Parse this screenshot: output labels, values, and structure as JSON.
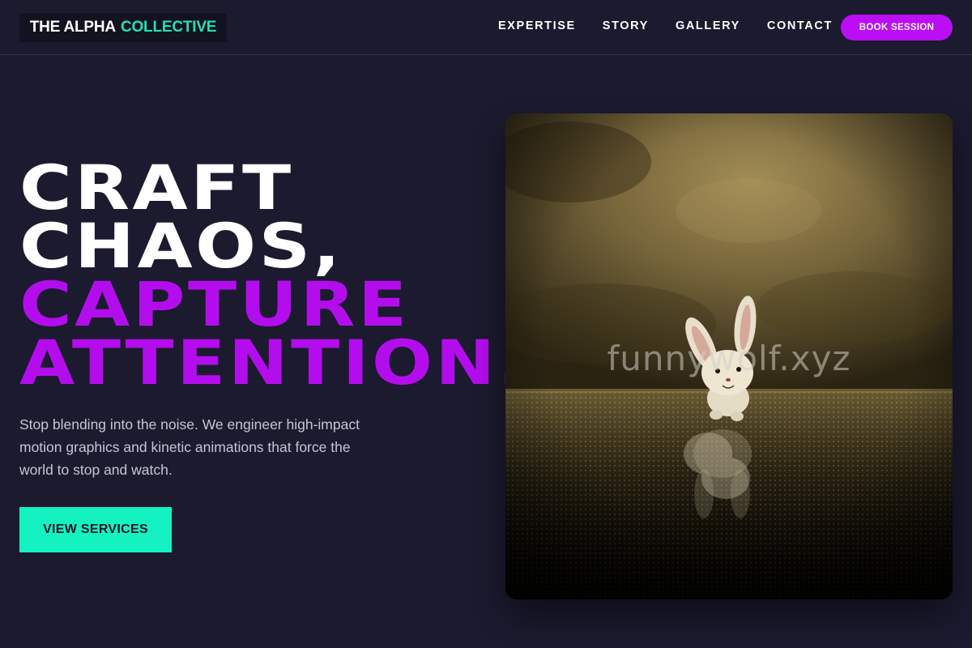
{
  "header": {
    "logo_part1": "THE ALPHA",
    "logo_part2": "COLLECTIVE",
    "nav": [
      {
        "label": "EXPERTISE"
      },
      {
        "label": "STORY"
      },
      {
        "label": "GALLERY"
      },
      {
        "label": "CONTACT"
      }
    ],
    "cta_label": "BOOK SESSION"
  },
  "hero": {
    "headline_lines": [
      "CRAFT",
      "CHAOS,",
      "CAPTURE",
      "ATTENTION."
    ],
    "lead": "Stop blending into the noise. We engineer high-impact motion graphics and kinetic animations that force the world to stop and watch.",
    "cta_label": "VIEW SERVICES",
    "image_watermark": "funnywolf.xyz"
  },
  "colors": {
    "background": "#1b1a2f",
    "accent_purple": "#b40ded",
    "accent_teal": "#14f2c2",
    "logo_teal": "#25e0b0"
  }
}
